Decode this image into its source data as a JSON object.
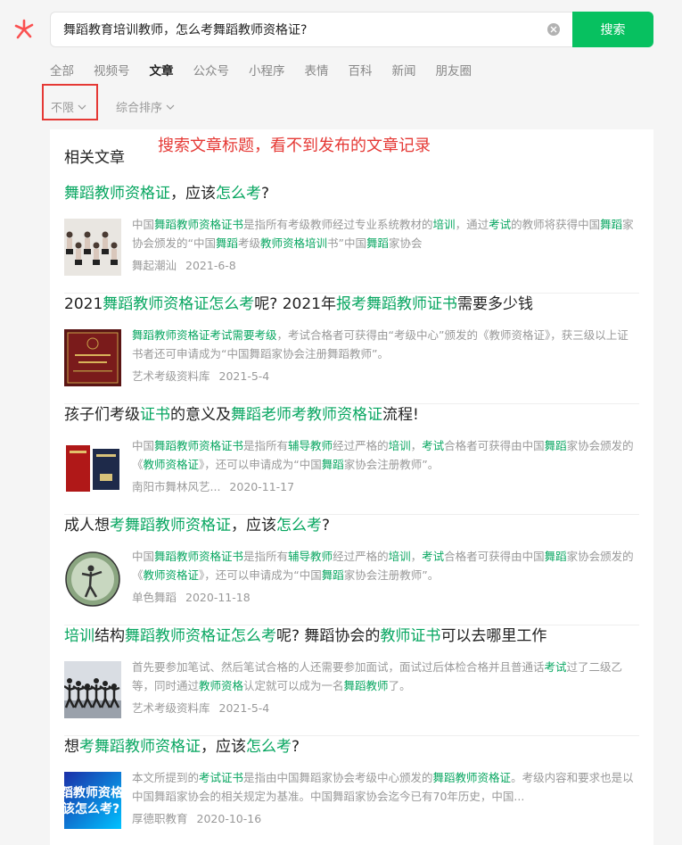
{
  "search": {
    "query": "舞蹈教育培训教师，怎么考舞蹈教师资格证?",
    "button_label": "搜索"
  },
  "tabs": [
    {
      "label": "全部",
      "active": false
    },
    {
      "label": "视频号",
      "active": false
    },
    {
      "label": "文章",
      "active": true
    },
    {
      "label": "公众号",
      "active": false
    },
    {
      "label": "小程序",
      "active": false
    },
    {
      "label": "表情",
      "active": false
    },
    {
      "label": "百科",
      "active": false
    },
    {
      "label": "新闻",
      "active": false
    },
    {
      "label": "朋友圈",
      "active": false
    }
  ],
  "filters": {
    "time_label": "不限",
    "sort_label": "综合排序"
  },
  "annotation": "搜索文章标题，看不到发布的文章记录",
  "section_title": "相关文章",
  "colors": {
    "accent": "#07c160",
    "highlight": "#07a660",
    "annotation": "#e53935"
  },
  "articles": [
    {
      "title": [
        [
          "舞蹈教师资格证",
          true
        ],
        [
          "，应该",
          false
        ],
        [
          "怎么考",
          true
        ],
        [
          "?",
          false
        ]
      ],
      "desc": [
        [
          "中国",
          false
        ],
        [
          "舞蹈教师资格证书",
          true
        ],
        [
          "是指所有考级教师经过专业系统教材的",
          false
        ],
        [
          "培训",
          true
        ],
        [
          "，通过",
          false
        ],
        [
          "考试",
          true
        ],
        [
          "的教师将获得中国",
          false
        ],
        [
          "舞蹈",
          true
        ],
        [
          "家协会颁发的“中国",
          false
        ],
        [
          "舞蹈",
          true
        ],
        [
          "考级",
          false
        ],
        [
          "教师资格培训",
          true
        ],
        [
          "书”中国",
          false
        ],
        [
          "舞蹈",
          true
        ],
        [
          "家协会",
          false
        ]
      ],
      "source": "舞起潮汕",
      "date": "2021-6-8",
      "thumb": "dancers-photo"
    },
    {
      "title": [
        [
          "2021",
          false
        ],
        [
          "舞蹈教师资格证怎么考",
          true
        ],
        [
          "呢? 2021年",
          false
        ],
        [
          "报考舞蹈教师证书",
          true
        ],
        [
          "需要多少钱",
          false
        ]
      ],
      "desc": [
        [
          "舞蹈教师资格证考试需要考级",
          true
        ],
        [
          "，考试合格者可获得由“考级中心”颁发的《教师资格证》，获三级以上证书者还可申请成为“中国舞蹈家协会注册舞蹈教师”。",
          false
        ]
      ],
      "source": "艺术考级资料库",
      "date": "2021-5-4",
      "thumb": "certificate-photo"
    },
    {
      "title": [
        [
          "孩子们考级",
          false
        ],
        [
          "证书",
          true
        ],
        [
          "的意义及",
          false
        ],
        [
          "舞蹈老师考教师资格证",
          true
        ],
        [
          "流程!",
          false
        ]
      ],
      "desc": [
        [
          "中国",
          false
        ],
        [
          "舞蹈教师资格证书",
          true
        ],
        [
          "是指所有",
          false
        ],
        [
          "辅导教师",
          true
        ],
        [
          "经过严格的",
          false
        ],
        [
          "培训",
          true
        ],
        [
          "，",
          false
        ],
        [
          "考试",
          true
        ],
        [
          "合格者可获得由中国",
          false
        ],
        [
          "舞蹈",
          true
        ],
        [
          "家协会颁发的《",
          false
        ],
        [
          "教师资格证",
          true
        ],
        [
          "》，还可以申请成为“中国",
          false
        ],
        [
          "舞蹈",
          true
        ],
        [
          "家协会注册教师”。",
          false
        ]
      ],
      "source": "南阳市舞林风艺...",
      "date": "2020-11-17",
      "thumb": "books-photo"
    },
    {
      "title": [
        [
          "成人想",
          false
        ],
        [
          "考舞蹈教师资格证",
          true
        ],
        [
          "，应该",
          false
        ],
        [
          "怎么考",
          true
        ],
        [
          "?",
          false
        ]
      ],
      "desc": [
        [
          "中国",
          false
        ],
        [
          "舞蹈教师资格证书",
          true
        ],
        [
          "是指所有",
          false
        ],
        [
          "辅导教师",
          true
        ],
        [
          "经过严格的",
          false
        ],
        [
          "培训",
          true
        ],
        [
          "，",
          false
        ],
        [
          "考试",
          true
        ],
        [
          "合格者可获得由中国",
          false
        ],
        [
          "舞蹈",
          true
        ],
        [
          "家协会颁发的《",
          false
        ],
        [
          "教师资格证",
          true
        ],
        [
          "》，还可以申请成为“中国",
          false
        ],
        [
          "舞蹈",
          true
        ],
        [
          "家协会注册教师”。",
          false
        ]
      ],
      "source": "单色舞蹈",
      "date": "2020-11-18",
      "thumb": "dancer-circle-photo"
    },
    {
      "title": [
        [
          "培训",
          true
        ],
        [
          "结构",
          false
        ],
        [
          "舞蹈教师资格证怎么考",
          true
        ],
        [
          "呢? 舞蹈协会的",
          false
        ],
        [
          "教师证书",
          true
        ],
        [
          "可以去哪里工作",
          false
        ]
      ],
      "desc": [
        [
          "首先要参加笔试、然后笔试合格的人还需要参加面试，面试过后体检合格并且普通话",
          false
        ],
        [
          "考试",
          true
        ],
        [
          "过了二级乙等，同时通过",
          false
        ],
        [
          "教师资格",
          true
        ],
        [
          "认定就可以成为一名",
          false
        ],
        [
          "舞蹈教师",
          true
        ],
        [
          "了。",
          false
        ]
      ],
      "source": "艺术考级资料库",
      "date": "2021-5-4",
      "thumb": "stage-dancers-photo"
    },
    {
      "title": [
        [
          "想",
          false
        ],
        [
          "考舞蹈教师资格证",
          true
        ],
        [
          "，应该",
          false
        ],
        [
          "怎么考",
          true
        ],
        [
          "?",
          false
        ]
      ],
      "desc": [
        [
          "本文所提到的",
          false
        ],
        [
          "考试证书",
          true
        ],
        [
          "是指由中国舞蹈家协会考级中心颁发的",
          false
        ],
        [
          "舞蹈教师资格证",
          true
        ],
        [
          "。考级内容和要求也是以中国舞蹈家协会的相关规定为基准。中国舞蹈家协会迄今已有70年历史，中国...",
          false
        ]
      ],
      "source": "厚德职教育",
      "date": "2020-10-16",
      "thumb": "banner-photo",
      "thumb_text": [
        "蹈教师资格",
        "该怎么考?"
      ]
    }
  ]
}
